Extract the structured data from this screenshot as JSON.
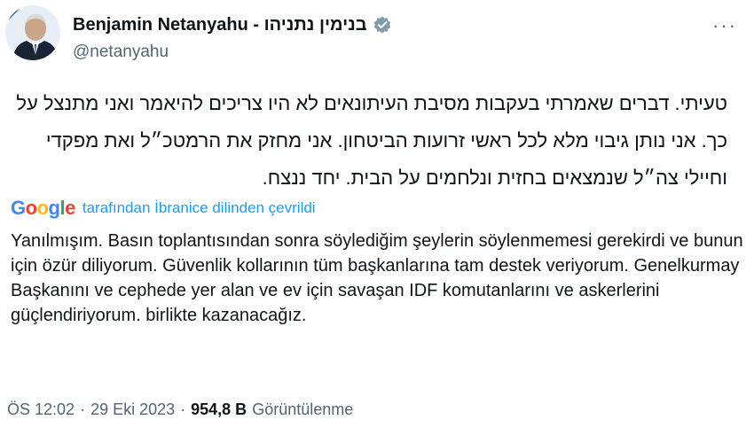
{
  "author": {
    "display_name": "Benjamin Netanyahu - בנימין נתניהו",
    "handle": "@netanyahu",
    "verified_color": "#829aab"
  },
  "menu": {
    "more_label": "···"
  },
  "tweet": {
    "original_text": "טעיתי. דברים שאמרתי בעקבות מסיבת העיתונאים לא היו צריכים להיאמר ואני מתנצל על כך. אני נותן גיבוי מלא לכל ראשי זרועות הביטחון. אני מחזק את הרמטכ״ל ואת מפקדי וחיילי צה״ל שנמצאים בחזית ונלחמים על הבית. יחד ננצח.",
    "translation_label": "tarafından İbranice dilinden çevrildi",
    "translated_text": "Yanılmışım. Basın toplantısından sonra söylediğim şeylerin söylenmemesi gerekirdi ve bunun için özür diliyorum. Güvenlik kollarının tüm başkanlarına tam destek veriyorum. Genelkurmay Başkanını ve cephede yer alan ve ev için savaşan IDF komutanlarını ve askerlerini güçlendiriyorum. birlikte kazanacağız."
  },
  "google_logo": {
    "letters": [
      "G",
      "o",
      "o",
      "g",
      "l",
      "e"
    ],
    "colors": [
      "#4285F4",
      "#EA4335",
      "#FBBC05",
      "#4285F4",
      "#34A853",
      "#EA4335"
    ]
  },
  "meta": {
    "time": "ÖS 12:02",
    "separator": "·",
    "date": "29 Eki 2023",
    "views_count": "954,8 B",
    "views_label": "Görüntülenme"
  }
}
